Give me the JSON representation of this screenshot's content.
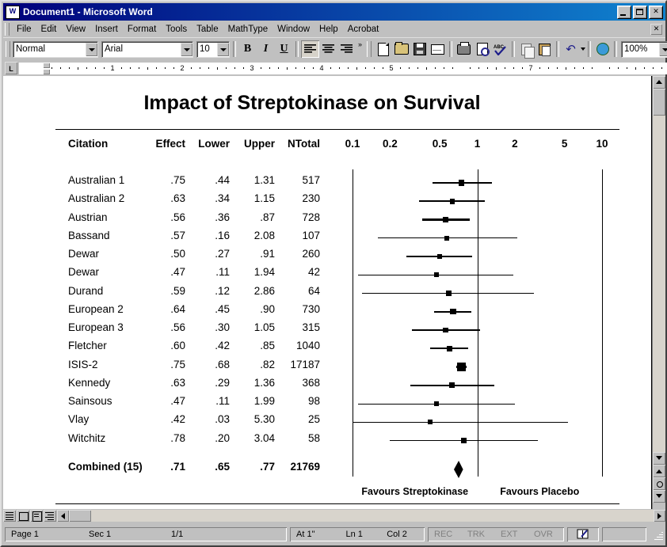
{
  "window": {
    "title": "Document1 - Microsoft Word",
    "icon": "word-document-icon",
    "buttons": {
      "minimize": "_",
      "maximize": "□",
      "close": "✕"
    }
  },
  "menubar": {
    "items": [
      "File",
      "Edit",
      "View",
      "Insert",
      "Format",
      "Tools",
      "Table",
      "MathType",
      "Window",
      "Help",
      "Acrobat"
    ],
    "close_doc": "✕"
  },
  "toolbar": {
    "style_value": "Normal",
    "font_value": "Arial",
    "size_value": "10",
    "zoom_value": "100%",
    "bold_label": "B",
    "italic_label": "I",
    "underline_label": "U",
    "spell_label": "ABC",
    "undo_label": "↶",
    "help_label": "?",
    "overflow_label": "»"
  },
  "ruler": {
    "numbers": [
      "1",
      "2",
      "3",
      "4",
      "5",
      "7"
    ],
    "corner_label": "L"
  },
  "statusbar": {
    "page": "Page 1",
    "section": "Sec 1",
    "pages": "1/1",
    "at": "At 1\"",
    "line": "Ln 1",
    "column": "Col 2",
    "rec": "REC",
    "trk": "TRK",
    "ext": "EXT",
    "ovr": "OVR"
  },
  "chart_data": {
    "type": "forest",
    "title": "Impact of Streptokinase on Survival",
    "columns": [
      "Citation",
      "Effect",
      "Lower",
      "Upper",
      "NTotal"
    ],
    "axis_ticks": [
      "0.1",
      "0.2",
      "0.5",
      "1",
      "2",
      "5",
      "10"
    ],
    "axis_tick_values": [
      0.1,
      0.2,
      0.5,
      1,
      2,
      5,
      10
    ],
    "xlim": [
      0.1,
      10
    ],
    "xscale": "log",
    "null_line": 1,
    "left_footer": "Favours Streptokinase",
    "right_footer": "Favours Placebo",
    "rows": [
      {
        "citation": "Australian 1",
        "effect": ".75",
        "lower": ".44",
        "upper": "1.31",
        "ntotal": "517",
        "e": 0.75,
        "l": 0.44,
        "u": 1.31,
        "n": 517
      },
      {
        "citation": "Australian 2",
        "effect": ".63",
        "lower": ".34",
        "upper": "1.15",
        "ntotal": "230",
        "e": 0.63,
        "l": 0.34,
        "u": 1.15,
        "n": 230
      },
      {
        "citation": "Austrian",
        "effect": ".56",
        "lower": ".36",
        "upper": ".87",
        "ntotal": "728",
        "e": 0.56,
        "l": 0.36,
        "u": 0.87,
        "n": 728
      },
      {
        "citation": "Bassand",
        "effect": ".57",
        "lower": ".16",
        "upper": "2.08",
        "ntotal": "107",
        "e": 0.57,
        "l": 0.16,
        "u": 2.08,
        "n": 107
      },
      {
        "citation": "Dewar",
        "effect": ".50",
        "lower": ".27",
        "upper": ".91",
        "ntotal": "260",
        "e": 0.5,
        "l": 0.27,
        "u": 0.91,
        "n": 260
      },
      {
        "citation": "Dewar",
        "effect": ".47",
        "lower": ".11",
        "upper": "1.94",
        "ntotal": "42",
        "e": 0.47,
        "l": 0.11,
        "u": 1.94,
        "n": 42
      },
      {
        "citation": "Durand",
        "effect": ".59",
        "lower": ".12",
        "upper": "2.86",
        "ntotal": "64",
        "e": 0.59,
        "l": 0.12,
        "u": 2.86,
        "n": 64
      },
      {
        "citation": "European 2",
        "effect": ".64",
        "lower": ".45",
        "upper": ".90",
        "ntotal": "730",
        "e": 0.64,
        "l": 0.45,
        "u": 0.9,
        "n": 730
      },
      {
        "citation": "European 3",
        "effect": ".56",
        "lower": ".30",
        "upper": "1.05",
        "ntotal": "315",
        "e": 0.56,
        "l": 0.3,
        "u": 1.05,
        "n": 315
      },
      {
        "citation": "Fletcher",
        "effect": ".60",
        "lower": ".42",
        "upper": ".85",
        "ntotal": "1040",
        "e": 0.6,
        "l": 0.42,
        "u": 0.85,
        "n": 1040
      },
      {
        "citation": "ISIS-2",
        "effect": ".75",
        "lower": ".68",
        "upper": ".82",
        "ntotal": "17187",
        "e": 0.75,
        "l": 0.68,
        "u": 0.82,
        "n": 17187
      },
      {
        "citation": "Kennedy",
        "effect": ".63",
        "lower": ".29",
        "upper": "1.36",
        "ntotal": "368",
        "e": 0.63,
        "l": 0.29,
        "u": 1.36,
        "n": 368
      },
      {
        "citation": "Sainsous",
        "effect": ".47",
        "lower": ".11",
        "upper": "1.99",
        "ntotal": "98",
        "e": 0.47,
        "l": 0.11,
        "u": 1.99,
        "n": 98
      },
      {
        "citation": "Vlay",
        "effect": ".42",
        "lower": ".03",
        "upper": "5.30",
        "ntotal": "25",
        "e": 0.42,
        "l": 0.03,
        "u": 5.3,
        "n": 25
      },
      {
        "citation": "Witchitz",
        "effect": ".78",
        "lower": ".20",
        "upper": "3.04",
        "ntotal": "58",
        "e": 0.78,
        "l": 0.2,
        "u": 3.04,
        "n": 58
      }
    ],
    "combined": {
      "citation": "Combined (15)",
      "effect": ".71",
      "lower": ".65",
      "upper": ".77",
      "ntotal": "21769",
      "e": 0.71,
      "l": 0.65,
      "u": 0.77,
      "n": 21769
    }
  }
}
